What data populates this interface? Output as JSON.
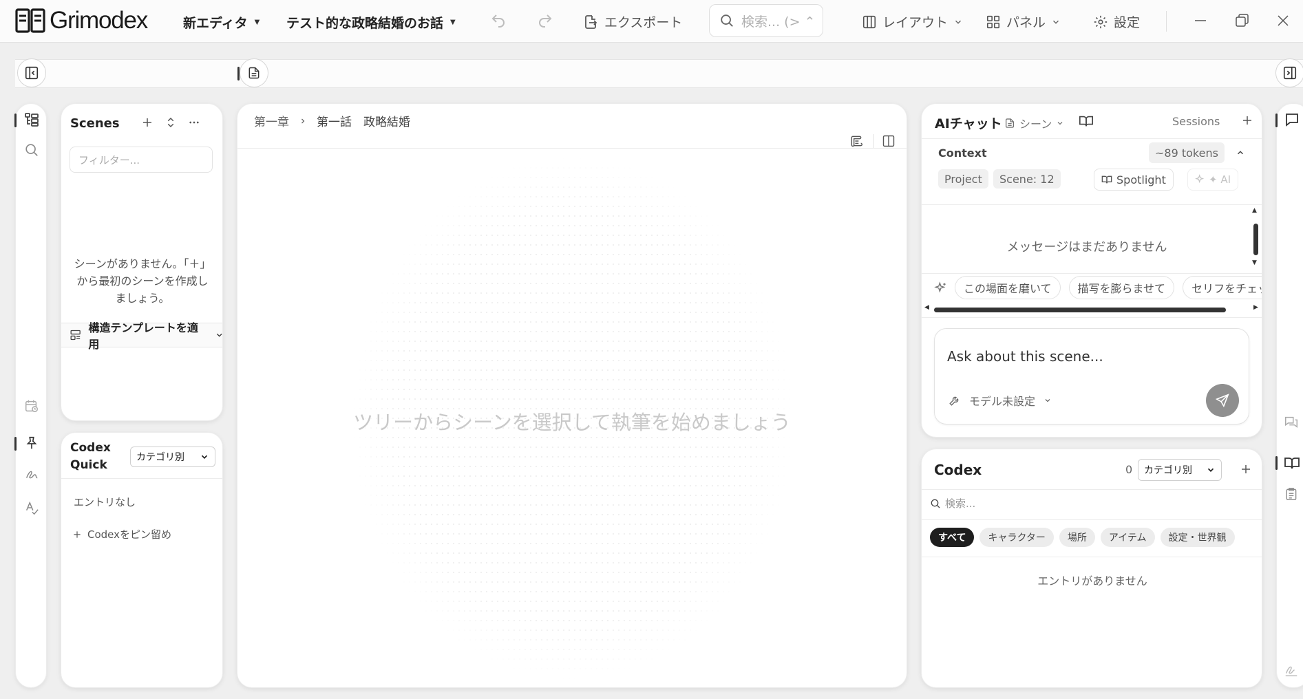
{
  "app": {
    "name": "Grimodex"
  },
  "menubar": {
    "editor_menu": "新エディタ",
    "project_menu": "テスト的な政略結婚のお話",
    "export": "エクスポート",
    "search_placeholder": "検索... (> ⌃",
    "layout": "レイアウト",
    "panel": "パネル",
    "settings": "設定"
  },
  "scenes": {
    "title": "Scenes",
    "filter_placeholder": "フィルター...",
    "empty_line1": "シーンがありません。「＋」",
    "empty_line2": "から最初のシーンを作成し",
    "empty_line3": "ましょう。",
    "template_button": "構造テンプレートを適用"
  },
  "codex_quick": {
    "title_line1": "Codex",
    "title_line2": "Quick",
    "category_select": "カテゴリ別",
    "empty": "エントリなし",
    "pin_action": "Codexをピン留め"
  },
  "editor": {
    "breadcrumb": [
      "第一章",
      "第一話　政略結婚"
    ],
    "hint": "ツリーからシーンを選択して執筆を始めましょう"
  },
  "ai_chat": {
    "title": "AIチャット",
    "scope": "シーン",
    "sessions": "Sessions",
    "context_label": "Context",
    "tokens": "~89 tokens",
    "chips": [
      "Project",
      "Scene: 12"
    ],
    "spotlight": "Spotlight",
    "ai_button": "✦ AI",
    "empty": "メッセージはまだありません",
    "suggestions": [
      "この場面を磨いて",
      "描写を膨らませて",
      "セリフをチェック"
    ],
    "input_placeholder": "Ask about this scene...",
    "model": "モデル未設定"
  },
  "codex": {
    "title": "Codex",
    "count": "0",
    "category_select": "カテゴリ別",
    "search_placeholder": "検索...",
    "tabs": [
      "すべて",
      "キャラクター",
      "場所",
      "アイテム",
      "設定・世界観"
    ],
    "empty": "エントリがありません"
  },
  "colors": {
    "accent_dark": "#1e1e1e",
    "send_button": "#8f8f8f"
  }
}
